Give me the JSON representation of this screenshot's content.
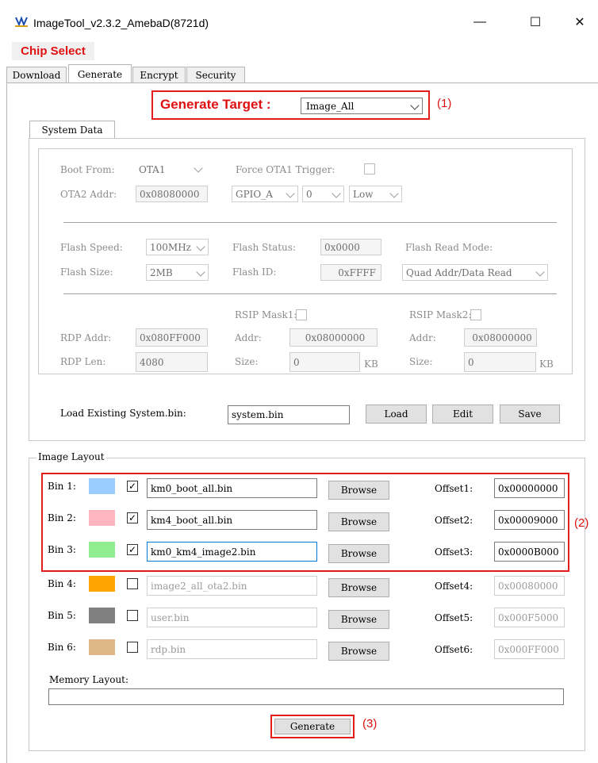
{
  "window": {
    "title": "ImageTool_v2.3.2_AmebaD(8721d)",
    "minimize": "—",
    "maximize": "☐",
    "close": "✕"
  },
  "chip_select": "Chip Select",
  "tabs": [
    "Download",
    "Generate",
    "Encrypt",
    "Security"
  ],
  "generate_target": {
    "label": "Generate Target :",
    "value": "Image_All",
    "annotation": "(1)"
  },
  "system_data": {
    "tab": "System Data",
    "boot_from_label": "Boot From:",
    "boot_from_value": "OTA1",
    "force_ota1_label": "Force OTA1 Trigger:",
    "ota2_addr_label": "OTA2 Addr:",
    "ota2_addr_value": "0x08080000",
    "gpio_value": "GPIO_A",
    "pin_value": "0",
    "level_value": "Low",
    "flash_speed_label": "Flash Speed:",
    "flash_speed_value": "100MHz",
    "flash_status_label": "Flash Status:",
    "flash_status_value": "0x0000",
    "flash_read_mode_label": "Flash Read Mode:",
    "flash_read_mode_value": "Quad Addr/Data Read",
    "flash_size_label": "Flash Size:",
    "flash_size_value": "2MB",
    "flash_id_label": "Flash ID:",
    "flash_id_value": "0xFFFF",
    "rsip_mask1_label": "RSIP Mask1:",
    "rsip_mask2_label": "RSIP Mask2:",
    "rdp_addr_label": "RDP Addr:",
    "rdp_addr_value": "0x080FF000",
    "addr_label": "Addr:",
    "rsip1_addr_value": "0x08000000",
    "rsip2_addr_value": "0x08000000",
    "rdp_len_label": "RDP Len:",
    "rdp_len_value": "4080",
    "size_label": "Size:",
    "rsip1_size_value": "0",
    "rsip2_size_value": "0",
    "kb": "KB",
    "load_existing_label": "Load Existing System.bin:",
    "load_existing_value": "system.bin",
    "load_button": "Load",
    "edit_button": "Edit",
    "save_button": "Save"
  },
  "image_layout": {
    "legend": "Image Layout",
    "browse": "Browse",
    "annotation": "(2)",
    "bins": [
      {
        "label": "Bin 1:",
        "color": "#99ccff",
        "checked": true,
        "file": "km0_boot_all.bin",
        "offset_label": "Offset1:",
        "offset": "0x00000000"
      },
      {
        "label": "Bin 2:",
        "color": "#ffb6c1",
        "checked": true,
        "file": "km4_boot_all.bin",
        "offset_label": "Offset2:",
        "offset": "0x00009000"
      },
      {
        "label": "Bin 3:",
        "color": "#90ee90",
        "checked": true,
        "file": "km0_km4_image2.bin",
        "offset_label": "Offset3:",
        "offset": "0x0000B000"
      },
      {
        "label": "Bin 4:",
        "color": "#ffa500",
        "checked": false,
        "file": "image2_all_ota2.bin",
        "offset_label": "Offset4:",
        "offset": "0x00080000"
      },
      {
        "label": "Bin 5:",
        "color": "#808080",
        "checked": false,
        "file": "user.bin",
        "offset_label": "Offset5:",
        "offset": "0x000F5000"
      },
      {
        "label": "Bin 6:",
        "color": "#deb887",
        "checked": false,
        "file": "rdp.bin",
        "offset_label": "Offset6:",
        "offset": "0x000FF000"
      }
    ],
    "memory_layout_label": "Memory Layout:",
    "generate_button": "Generate",
    "generate_annotation": "(3)"
  }
}
